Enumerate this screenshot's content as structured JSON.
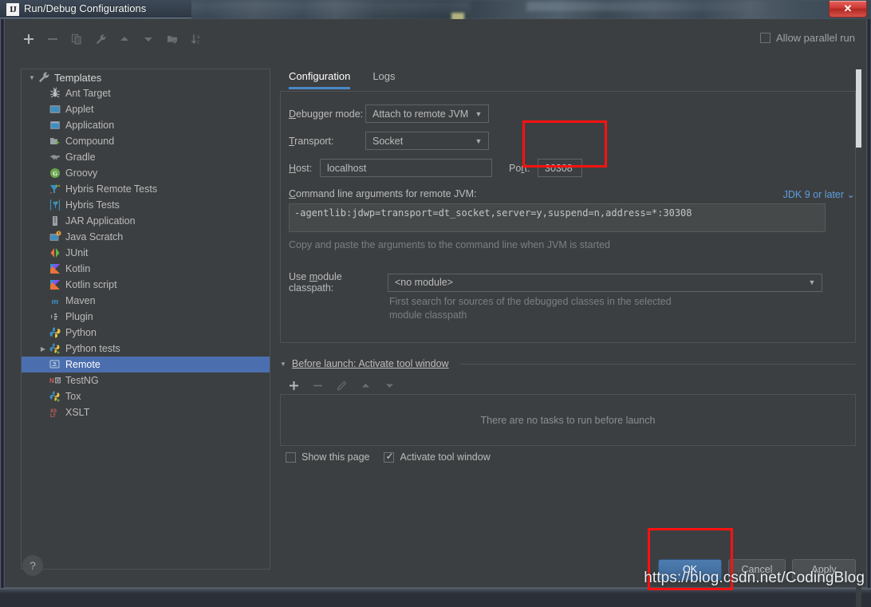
{
  "window": {
    "title": "Run/Debug Configurations",
    "app_icon": "intellij-idea-icon",
    "close_label": "✕"
  },
  "toolbar": {
    "buttons": [
      {
        "name": "add-configuration-button",
        "icon": "plus-icon",
        "enabled": true
      },
      {
        "name": "remove-configuration-button",
        "icon": "minus-icon",
        "enabled": false
      },
      {
        "name": "copy-configuration-button",
        "icon": "copy-icon",
        "enabled": false
      },
      {
        "name": "edit-templates-button",
        "icon": "wrench-icon",
        "enabled": false
      },
      {
        "name": "move-up-button",
        "icon": "arrow-up-icon",
        "enabled": false
      },
      {
        "name": "move-down-button",
        "icon": "arrow-down-icon",
        "enabled": false
      },
      {
        "name": "move-into-folder-button",
        "icon": "folder-add-icon",
        "enabled": false
      },
      {
        "name": "sort-configurations-button",
        "icon": "sort-az-icon",
        "enabled": false
      }
    ],
    "allow_parallel_run": {
      "label": "Allow parallel run",
      "mnemonic": "u",
      "checked": false
    }
  },
  "tree": {
    "root": {
      "label": "Templates",
      "icon": "wrench-icon",
      "expanded": true
    },
    "items": [
      {
        "label": "Ant Target",
        "icon": "ant-icon",
        "selected": false,
        "expandable": false
      },
      {
        "label": "Applet",
        "icon": "applet-icon",
        "selected": false,
        "expandable": false
      },
      {
        "label": "Application",
        "icon": "application-icon",
        "selected": false,
        "expandable": false
      },
      {
        "label": "Compound",
        "icon": "compound-icon",
        "selected": false,
        "expandable": false
      },
      {
        "label": "Gradle",
        "icon": "gradle-elephant-icon",
        "selected": false,
        "expandable": false
      },
      {
        "label": "Groovy",
        "icon": "groovy-icon",
        "selected": false,
        "expandable": false
      },
      {
        "label": "Hybris Remote Tests",
        "icon": "hybris-remote-tests-icon",
        "selected": false,
        "expandable": false
      },
      {
        "label": "Hybris Tests",
        "icon": "hybris-tests-icon",
        "selected": false,
        "expandable": false
      },
      {
        "label": "JAR Application",
        "icon": "jar-icon",
        "selected": false,
        "expandable": false
      },
      {
        "label": "Java Scratch",
        "icon": "java-scratch-icon",
        "selected": false,
        "expandable": false
      },
      {
        "label": "JUnit",
        "icon": "junit-icon",
        "selected": false,
        "expandable": false
      },
      {
        "label": "Kotlin",
        "icon": "kotlin-icon",
        "selected": false,
        "expandable": false
      },
      {
        "label": "Kotlin script",
        "icon": "kotlin-icon",
        "selected": false,
        "expandable": false
      },
      {
        "label": "Maven",
        "icon": "maven-icon",
        "selected": false,
        "expandable": false
      },
      {
        "label": "Plugin",
        "icon": "plugin-icon",
        "selected": false,
        "expandable": false
      },
      {
        "label": "Python",
        "icon": "python-icon",
        "selected": false,
        "expandable": false
      },
      {
        "label": "Python tests",
        "icon": "python-tests-icon",
        "selected": false,
        "expandable": true
      },
      {
        "label": "Remote",
        "icon": "remote-icon",
        "selected": true,
        "expandable": false
      },
      {
        "label": "TestNG",
        "icon": "testng-icon",
        "selected": false,
        "expandable": false
      },
      {
        "label": "Tox",
        "icon": "tox-icon",
        "selected": false,
        "expandable": false
      },
      {
        "label": "XSLT",
        "icon": "xslt-icon",
        "selected": false,
        "expandable": false
      }
    ]
  },
  "tabs": [
    {
      "label": "Configuration",
      "active": true
    },
    {
      "label": "Logs",
      "active": false
    }
  ],
  "configuration": {
    "debugger_mode": {
      "label": "Debugger mode:",
      "value": "Attach to remote JVM"
    },
    "transport": {
      "label": "Transport:",
      "value": "Socket"
    },
    "host": {
      "label": "Host:",
      "value": "localhost"
    },
    "port": {
      "label": "Port:",
      "value": "30308"
    },
    "command_line": {
      "label": "Command line arguments for remote JVM:",
      "value": "-agentlib:jdwp=transport=dt_socket,server=y,suspend=n,address=*:30308",
      "hint": "Copy and paste the arguments to the command line when JVM is started",
      "jdk_selector": "JDK 9 or later"
    },
    "module_classpath": {
      "label": "Use module classpath:",
      "value": "<no module>",
      "hint_line1": "First search for sources of the debugged classes in the selected",
      "hint_line2": "module classpath"
    }
  },
  "before_launch": {
    "title": "Before launch: Activate tool window",
    "expanded": true,
    "toolbar": [
      {
        "name": "add-task-button",
        "icon": "plus-icon",
        "enabled": true
      },
      {
        "name": "remove-task-button",
        "icon": "minus-icon",
        "enabled": false
      },
      {
        "name": "edit-task-button",
        "icon": "pencil-icon",
        "enabled": false
      },
      {
        "name": "move-task-up-button",
        "icon": "arrow-up-icon",
        "enabled": false
      },
      {
        "name": "move-task-down-button",
        "icon": "arrow-down-icon",
        "enabled": false
      }
    ],
    "empty_message": "There are no tasks to run before launch",
    "show_this_page": {
      "label": "Show this page",
      "checked": false
    },
    "activate_tool_window": {
      "label": "Activate tool window",
      "checked": true
    }
  },
  "footer": {
    "help_label": "?",
    "ok_label": "OK",
    "cancel_label": "Cancel",
    "apply_label": "Apply"
  },
  "annotations": {
    "watermark": "https://blog.csdn.net/CodingBlog",
    "highlight_color": "#ff1111",
    "highlights": [
      {
        "target": "port-field"
      },
      {
        "target": "ok-button"
      }
    ]
  },
  "colors": {
    "accent_blue": "#4b6eaf",
    "tab_underline": "#4a88c7",
    "link_blue": "#5c9ede",
    "panel_bg": "#3c3f41",
    "close_red": "#cf3a34"
  }
}
